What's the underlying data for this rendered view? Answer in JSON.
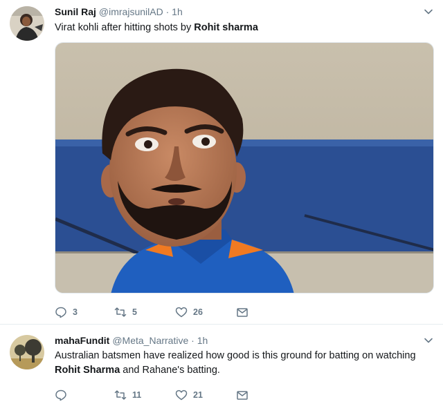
{
  "tweets": [
    {
      "author_name": "Sunil Raj",
      "author_handle": "@imrajsunilAD",
      "separator": "·",
      "time": "1h",
      "text_parts": [
        "Virat kohli after hitting shots by ",
        "Rohit sharma"
      ],
      "counts": {
        "reply": "3",
        "retweet": "5",
        "like": "26"
      }
    },
    {
      "author_name": "mahaFundit",
      "author_handle": "@Meta_Narrative",
      "separator": "·",
      "time": "1h",
      "text_parts": [
        "Australian batsmen have realized how good is this ground for batting on watching ",
        "Rohit Sharma",
        " and Rahane's batting."
      ],
      "counts": {
        "reply": "",
        "retweet": "11",
        "like": "21"
      }
    }
  ],
  "colors": {
    "text": "#14171a",
    "secondary": "#657786",
    "divider": "#e6ecf0"
  },
  "icons": [
    "avatar",
    "chevron-down-icon",
    "reply-icon",
    "retweet-icon",
    "like-icon",
    "direct-message-icon"
  ]
}
